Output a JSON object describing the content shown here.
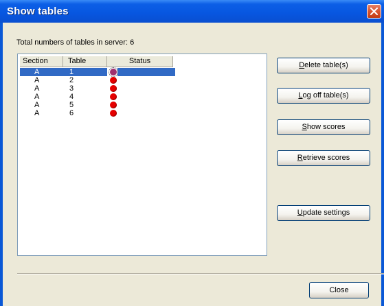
{
  "window": {
    "title": "Show tables"
  },
  "info": {
    "total_label": "Total numbers of tables in server: 6"
  },
  "list": {
    "columns": [
      "Section",
      "Table",
      "Status"
    ],
    "rows": [
      {
        "section": "A",
        "table": "1",
        "status_color": "#a0306e",
        "selected": true
      },
      {
        "section": "A",
        "table": "2",
        "status_color": "#e60000",
        "selected": false
      },
      {
        "section": "A",
        "table": "3",
        "status_color": "#e60000",
        "selected": false
      },
      {
        "section": "A",
        "table": "4",
        "status_color": "#e60000",
        "selected": false
      },
      {
        "section": "A",
        "table": "5",
        "status_color": "#e60000",
        "selected": false
      },
      {
        "section": "A",
        "table": "6",
        "status_color": "#e60000",
        "selected": false
      }
    ]
  },
  "buttons": {
    "delete": {
      "first": "D",
      "rest": "elete table(s)"
    },
    "logoff": {
      "first": "L",
      "rest": "og off table(s)"
    },
    "show_scores": {
      "first": "S",
      "rest": "how scores"
    },
    "retrieve": {
      "first": "R",
      "rest": "etrieve scores"
    },
    "update": {
      "first": "U",
      "rest": "pdate settings"
    },
    "close": "Close"
  },
  "colors": {
    "selection": "#316ac5",
    "status_red": "#e60000",
    "titlebar": "#0756e0"
  },
  "icons": {
    "close": "close-x-icon",
    "status": "status-dot-icon"
  }
}
